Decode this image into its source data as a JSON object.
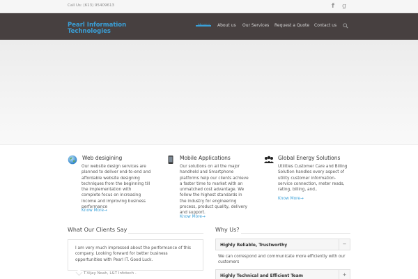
{
  "topbar": {
    "phone": "Call Us: (613) 95409613",
    "social": [
      {
        "icon": "facebook-icon",
        "glyph": "f"
      },
      {
        "icon": "google-plus-icon",
        "glyph": "g"
      }
    ]
  },
  "header": {
    "logo_line1": "Pearl Information",
    "logo_line2": "Technologies",
    "nav": [
      {
        "label": "Home",
        "active": true
      },
      {
        "label": "About us",
        "active": false
      },
      {
        "label": "Our Services",
        "active": false
      },
      {
        "label": "Request a Quote",
        "active": false
      },
      {
        "label": "Contact us",
        "active": false
      }
    ],
    "search_icon": "search-icon"
  },
  "services": [
    {
      "icon": "globe-icon",
      "title": "Web desigining",
      "body": "Our website design services are planned to deliver end-to-end and affordable website designing techniques from the beginning till the implementation with complete focus on increasing income and improving business performance",
      "more": "Know More→"
    },
    {
      "icon": "smartphone-icon",
      "title": "Mobile Applications",
      "body": "Our solutions on all the major handheld and Smartphone platforms help our clients achieve a faster time to market with an unmatched cost advantage. We follow the highest standards in the industry for engineering process, product quality, delivery and support.",
      "more": "Know More→"
    },
    {
      "icon": "people-icon",
      "title": "Global Energy Solutions",
      "body": "Utilities Customer Care and Billing Solution handles every aspect of utility customer information-service connection, meter reads, rating, billing, and..",
      "more": "Know More→"
    }
  ],
  "clients": {
    "title": "What Our Clients Say",
    "quote": "I am very much impressed about the performance of this company. Looking forward for better business opportunities with Pearl IT. Good Luck.",
    "author": "T.Vijay Noah, L&T Infotech ."
  },
  "why": {
    "title": "Why Us?",
    "items": [
      {
        "label": "Highly Reliable, Trustworthy",
        "toggle": "−",
        "expanded": true,
        "body": "We can correspond and communicate more efficiently with our customers"
      },
      {
        "label": "Highly Technical and Efficient Team",
        "toggle": "+",
        "expanded": false
      }
    ]
  },
  "colors": {
    "accent": "#3aa0d8",
    "header_bg": "#474040"
  }
}
